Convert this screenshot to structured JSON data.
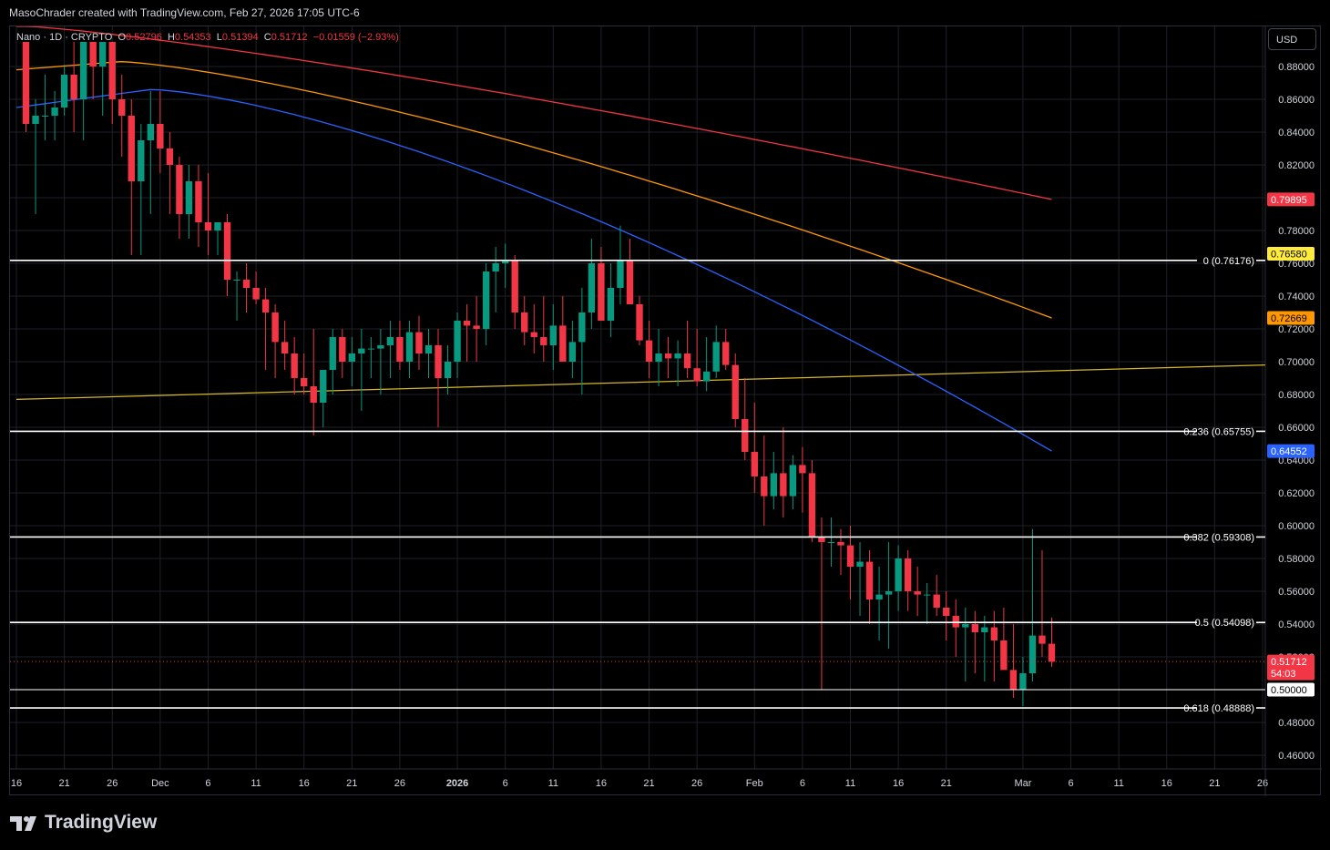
{
  "header": {
    "attribution": "MasoChrader created with TradingView.com, Feb 27, 2026 17:05 UTC-6"
  },
  "legend": {
    "symbol": "Nano · 1D · CRYPTO",
    "open_label": "O",
    "open": "0.52796",
    "high_label": "H",
    "high": "0.54353",
    "low_label": "L",
    "low": "0.51394",
    "close_label": "C",
    "close": "0.51712",
    "change": "−0.01559 (−2.93%)"
  },
  "currency_button": "USD",
  "brand": {
    "name": "TradingView"
  },
  "chart_data": {
    "type": "candlestick",
    "interval": "1D",
    "ylim": [
      0.45,
      0.895
    ],
    "y_ticks": [
      "0.88000",
      "0.86000",
      "0.84000",
      "0.82000",
      "0.80000",
      "0.78000",
      "0.76000",
      "0.74000",
      "0.72000",
      "0.70000",
      "0.68000",
      "0.66000",
      "0.64000",
      "0.62000",
      "0.60000",
      "0.58000",
      "0.56000",
      "0.54000",
      "0.52000",
      "0.50000",
      "0.48000",
      "0.46000"
    ],
    "x_ticks": [
      "16",
      "21",
      "26",
      "Dec",
      "6",
      "11",
      "16",
      "21",
      "26",
      "2026",
      "6",
      "11",
      "16",
      "21",
      "26",
      "Feb",
      "6",
      "11",
      "16",
      "21",
      "Mar",
      "6",
      "11",
      "16",
      "21",
      "26"
    ],
    "x_tick_days": [
      0,
      5,
      10,
      15,
      20,
      25,
      30,
      35,
      40,
      46,
      51,
      56,
      61,
      66,
      71,
      77,
      82,
      87,
      92,
      97,
      105,
      110,
      115,
      120,
      125,
      130
    ],
    "date_range": [
      "2025-11-16",
      "2026-03-28"
    ],
    "candles": [
      [
        0.895,
        0.895,
        0.84,
        0.845
      ],
      [
        0.845,
        0.86,
        0.79,
        0.85
      ],
      [
        0.85,
        0.875,
        0.835,
        0.85
      ],
      [
        0.85,
        0.865,
        0.835,
        0.855
      ],
      [
        0.855,
        0.88,
        0.85,
        0.875
      ],
      [
        0.875,
        0.895,
        0.84,
        0.86
      ],
      [
        0.86,
        0.895,
        0.835,
        0.895
      ],
      [
        0.895,
        0.895,
        0.86,
        0.88
      ],
      [
        0.88,
        0.89,
        0.85,
        0.895
      ],
      [
        0.895,
        0.895,
        0.845,
        0.86
      ],
      [
        0.86,
        0.875,
        0.825,
        0.85
      ],
      [
        0.85,
        0.86,
        0.765,
        0.81
      ],
      [
        0.81,
        0.845,
        0.765,
        0.835
      ],
      [
        0.835,
        0.865,
        0.79,
        0.845
      ],
      [
        0.845,
        0.865,
        0.815,
        0.83
      ],
      [
        0.83,
        0.84,
        0.79,
        0.82
      ],
      [
        0.82,
        0.825,
        0.775,
        0.79
      ],
      [
        0.79,
        0.82,
        0.775,
        0.81
      ],
      [
        0.81,
        0.82,
        0.77,
        0.785
      ],
      [
        0.785,
        0.815,
        0.765,
        0.78
      ],
      [
        0.78,
        0.785,
        0.765,
        0.785
      ],
      [
        0.785,
        0.79,
        0.74,
        0.75
      ],
      [
        0.75,
        0.755,
        0.725,
        0.75
      ],
      [
        0.75,
        0.76,
        0.73,
        0.745
      ],
      [
        0.745,
        0.755,
        0.735,
        0.738
      ],
      [
        0.738,
        0.745,
        0.695,
        0.73
      ],
      [
        0.73,
        0.735,
        0.69,
        0.712
      ],
      [
        0.712,
        0.725,
        0.695,
        0.705
      ],
      [
        0.705,
        0.715,
        0.68,
        0.69
      ],
      [
        0.69,
        0.705,
        0.68,
        0.685
      ],
      [
        0.685,
        0.72,
        0.655,
        0.675
      ],
      [
        0.675,
        0.69,
        0.66,
        0.695
      ],
      [
        0.695,
        0.72,
        0.68,
        0.715
      ],
      [
        0.715,
        0.72,
        0.69,
        0.7
      ],
      [
        0.7,
        0.715,
        0.685,
        0.705
      ],
      [
        0.705,
        0.72,
        0.67,
        0.708
      ],
      [
        0.708,
        0.715,
        0.69,
        0.708
      ],
      [
        0.708,
        0.72,
        0.68,
        0.71
      ],
      [
        0.71,
        0.725,
        0.69,
        0.715
      ],
      [
        0.715,
        0.725,
        0.695,
        0.7
      ],
      [
        0.7,
        0.725,
        0.69,
        0.718
      ],
      [
        0.718,
        0.728,
        0.695,
        0.705
      ],
      [
        0.705,
        0.72,
        0.69,
        0.71
      ],
      [
        0.71,
        0.72,
        0.66,
        0.69
      ],
      [
        0.69,
        0.71,
        0.68,
        0.7
      ],
      [
        0.7,
        0.73,
        0.69,
        0.725
      ],
      [
        0.725,
        0.735,
        0.7,
        0.722
      ],
      [
        0.722,
        0.74,
        0.7,
        0.72
      ],
      [
        0.72,
        0.76,
        0.71,
        0.755
      ],
      [
        0.755,
        0.77,
        0.73,
        0.76
      ],
      [
        0.76,
        0.772,
        0.745,
        0.762
      ],
      [
        0.762,
        0.765,
        0.72,
        0.73
      ],
      [
        0.73,
        0.74,
        0.71,
        0.718
      ],
      [
        0.718,
        0.735,
        0.705,
        0.715
      ],
      [
        0.715,
        0.74,
        0.7,
        0.71
      ],
      [
        0.71,
        0.735,
        0.695,
        0.722
      ],
      [
        0.722,
        0.74,
        0.7,
        0.7
      ],
      [
        0.7,
        0.725,
        0.69,
        0.712
      ],
      [
        0.712,
        0.745,
        0.68,
        0.73
      ],
      [
        0.73,
        0.775,
        0.72,
        0.76
      ],
      [
        0.76,
        0.77,
        0.73,
        0.725
      ],
      [
        0.725,
        0.76,
        0.715,
        0.745
      ],
      [
        0.745,
        0.783,
        0.735,
        0.762
      ],
      [
        0.762,
        0.775,
        0.74,
        0.735
      ],
      [
        0.735,
        0.74,
        0.71,
        0.713
      ],
      [
        0.713,
        0.725,
        0.69,
        0.7
      ],
      [
        0.7,
        0.72,
        0.685,
        0.705
      ],
      [
        0.705,
        0.715,
        0.69,
        0.702
      ],
      [
        0.702,
        0.713,
        0.685,
        0.705
      ],
      [
        0.705,
        0.725,
        0.69,
        0.696
      ],
      [
        0.696,
        0.72,
        0.685,
        0.688
      ],
      [
        0.688,
        0.715,
        0.682,
        0.694
      ],
      [
        0.694,
        0.722,
        0.69,
        0.712
      ],
      [
        0.712,
        0.72,
        0.695,
        0.698
      ],
      [
        0.698,
        0.705,
        0.66,
        0.665
      ],
      [
        0.665,
        0.69,
        0.64,
        0.645
      ],
      [
        0.645,
        0.675,
        0.62,
        0.63
      ],
      [
        0.63,
        0.655,
        0.6,
        0.618
      ],
      [
        0.618,
        0.645,
        0.61,
        0.632
      ],
      [
        0.632,
        0.66,
        0.605,
        0.618
      ],
      [
        0.618,
        0.643,
        0.61,
        0.637
      ],
      [
        0.637,
        0.648,
        0.608,
        0.632
      ],
      [
        0.632,
        0.64,
        0.59,
        0.593
      ],
      [
        0.593,
        0.605,
        0.5,
        0.59
      ],
      [
        0.59,
        0.605,
        0.575,
        0.59
      ],
      [
        0.59,
        0.598,
        0.57,
        0.588
      ],
      [
        0.588,
        0.6,
        0.555,
        0.575
      ],
      [
        0.575,
        0.59,
        0.545,
        0.578
      ],
      [
        0.578,
        0.585,
        0.54,
        0.555
      ],
      [
        0.555,
        0.575,
        0.53,
        0.558
      ],
      [
        0.558,
        0.59,
        0.525,
        0.56
      ],
      [
        0.56,
        0.588,
        0.548,
        0.58
      ],
      [
        0.58,
        0.585,
        0.548,
        0.56
      ],
      [
        0.56,
        0.575,
        0.545,
        0.558
      ],
      [
        0.558,
        0.565,
        0.54,
        0.558
      ],
      [
        0.558,
        0.57,
        0.545,
        0.55
      ],
      [
        0.55,
        0.56,
        0.53,
        0.545
      ],
      [
        0.545,
        0.555,
        0.52,
        0.538
      ],
      [
        0.538,
        0.55,
        0.505,
        0.54
      ],
      [
        0.54,
        0.548,
        0.51,
        0.535
      ],
      [
        0.535,
        0.545,
        0.505,
        0.538
      ],
      [
        0.538,
        0.548,
        0.505,
        0.53
      ],
      [
        0.53,
        0.55,
        0.52,
        0.512
      ],
      [
        0.512,
        0.54,
        0.495,
        0.5
      ],
      [
        0.5,
        0.52,
        0.49,
        0.51
      ],
      [
        0.51,
        0.598,
        0.505,
        0.533
      ],
      [
        0.533,
        0.585,
        0.52,
        0.528
      ],
      [
        0.528,
        0.544,
        0.514,
        0.517
      ]
    ],
    "moving_averages": [
      {
        "color": "#2962ff",
        "last": "0.64552"
      },
      {
        "color": "#ff9800",
        "last": "0.72669"
      },
      {
        "color": "#f23645",
        "last": "0.79895"
      }
    ],
    "trendline": {
      "color": "#d4b829",
      "from": [
        0,
        0.677
      ],
      "to": [
        132,
        0.698
      ]
    },
    "fib_levels": [
      {
        "label": "0 (0.76176)",
        "value": 0.76176
      },
      {
        "label": "0.236 (0.65755)",
        "value": 0.65755
      },
      {
        "label": "0.382 (0.59308)",
        "value": 0.59308
      },
      {
        "label": "0.5 (0.54098)",
        "value": 0.54098
      },
      {
        "label": "0.618 (0.48888)",
        "value": 0.48888
      }
    ],
    "extra_level": {
      "label": "0.50000",
      "value": 0.5
    },
    "price_tags": [
      {
        "label": "0.79895",
        "value": 0.79895,
        "bg": "#f23645",
        "fg": "#ffffff"
      },
      {
        "label": "0.76580",
        "value": 0.7658,
        "bg": "#ffeb3b",
        "fg": "#000000"
      },
      {
        "label": "0.72669",
        "value": 0.72669,
        "bg": "#ff9800",
        "fg": "#000000"
      },
      {
        "label": "0.64552",
        "value": 0.64552,
        "bg": "#2962ff",
        "fg": "#ffffff"
      },
      {
        "label": "0.51712",
        "sub": "54:03",
        "value": 0.51712,
        "bg": "#f23645",
        "fg": "#ffffff"
      },
      {
        "label": "0.50000",
        "value": 0.5,
        "bg": "#ffffff",
        "fg": "#000000"
      }
    ],
    "colors": {
      "up": "#089981",
      "down": "#f23645",
      "fib": "#ffffff",
      "grid": "#1e2128",
      "text": "#d1d4dc"
    }
  }
}
